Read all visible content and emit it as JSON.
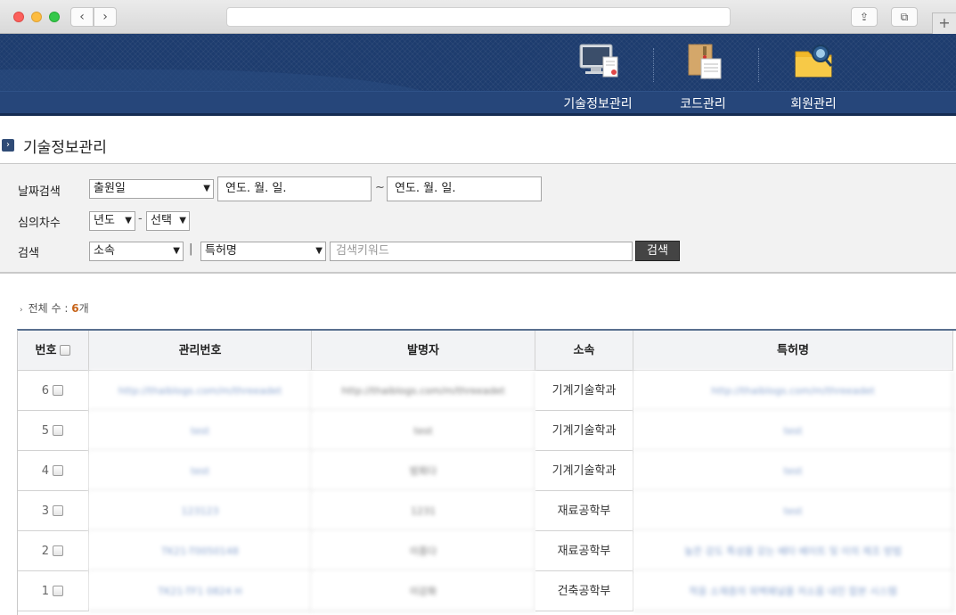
{
  "browser": {
    "back_glyph": "‹",
    "forward_glyph": "›",
    "share_glyph": "⇪",
    "tabs_glyph": "⧉",
    "newtab_glyph": "+"
  },
  "header": {
    "menu": [
      {
        "label": "기술정보관리",
        "icon": "monitor-document-icon"
      },
      {
        "label": "코드관리",
        "icon": "folder-papers-icon"
      },
      {
        "label": "회원관리",
        "icon": "folder-search-icon"
      }
    ]
  },
  "page": {
    "title": "기술정보관리",
    "title_glyph": "›"
  },
  "search": {
    "date_label": "날짜검색",
    "date_type": "출원일",
    "date_from_placeholder": "연도. 월. 일.",
    "date_to_placeholder": "연도. 월. 일.",
    "range_sep": "~",
    "session_label": "심의차수",
    "year_select": "년도",
    "dash": "-",
    "session_select": "선택",
    "keyword_label": "검색",
    "dept_select": "소속",
    "bar": "|",
    "field_select": "특허명",
    "keyword_placeholder": "검색키워드",
    "button": "검색",
    "caret": "▼"
  },
  "count": {
    "bullet": "›",
    "label": "전체 수 : ",
    "value": "6",
    "unit": "개"
  },
  "table": {
    "headers": [
      "번호",
      "관리번호",
      "발명자",
      "소속",
      "특허명"
    ],
    "rows": [
      {
        "no": "6",
        "mgmt": "http://thaiblogs.com/m/threeadet",
        "inventor": "http://thaiblogs.com/m/threeadet",
        "dept": "기계기술학과",
        "title": "http://thaiblogs.com/m/threeadet"
      },
      {
        "no": "5",
        "mgmt": "test",
        "inventor": "test",
        "dept": "기계기술학과",
        "title": "test"
      },
      {
        "no": "4",
        "mgmt": "test",
        "inventor": "밤회다",
        "dept": "기계기술학과",
        "title": "test"
      },
      {
        "no": "3",
        "mgmt": "123123",
        "inventor": "1231",
        "dept": "재료공학부",
        "title": "test"
      },
      {
        "no": "2",
        "mgmt": "TK21-T0050148",
        "inventor": "이종다",
        "dept": "재료공학부",
        "title": "높은 강도 특성을 갖는 베타 베이트 및 이의 제조 방법"
      },
      {
        "no": "1",
        "mgmt": "TK21-TF1 0824 H",
        "inventor": "이강화",
        "dept": "건축공학부",
        "title": "적응 소재층의 외벽패널을 저소음 내진 합본 시스템"
      }
    ]
  },
  "colors": {
    "header_bg": "#1d3c6e",
    "table_border_top": "#59708f",
    "count_accent": "#c7641a",
    "search_button_bg": "#444444"
  }
}
